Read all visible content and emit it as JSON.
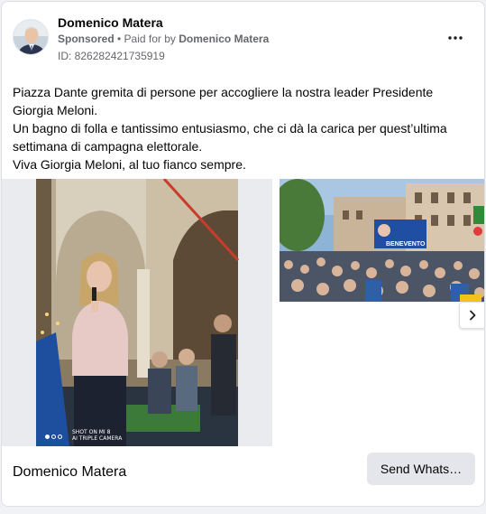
{
  "ad": {
    "page_name": "Domenico Matera",
    "sponsored_label": "Sponsored",
    "paid_for_prefix": " • Paid for by ",
    "paid_for_name": "Domenico Matera",
    "library_id": "ID: 826282421735919",
    "more_icon": "more-horizontal-icon",
    "body_lines": [
      "Piazza Dante gremita di persone per accogliere la nostra leader Presidente Giorgia Meloni.",
      "Un bagno di folla e tantissimo entusiasmo, che ci dà la carica per quest’ultima settimana di campagna elettorale.",
      "Viva Giorgia Meloni, al tuo fianco sempre."
    ],
    "footer_name": "Domenico Matera",
    "cta_label": "Send Whats…",
    "photo_watermark": "SHOT ON MI 8\nAI TRIPLE CAMERA",
    "banner_text": "BENEVENTO"
  },
  "colors": {
    "text_primary": "#050505",
    "text_secondary": "#65676b",
    "card_bg": "#ffffff",
    "cta_bg": "#e4e6eb",
    "page_bg": "#f0f2f5"
  }
}
